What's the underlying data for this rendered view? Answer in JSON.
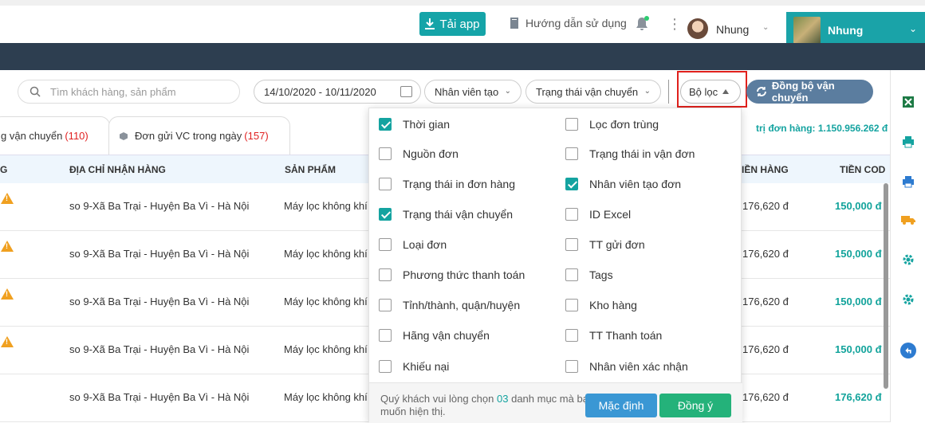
{
  "header": {
    "app_button_label": "Tải app",
    "guide_label": "Hướng dẫn sử dụng",
    "user_name": "Nhung",
    "shop_name": "Nhung"
  },
  "toolbar": {
    "search_placeholder": "Tìm khách hàng, sản phẩm",
    "date_range": "14/10/2020 - 10/11/2020",
    "creator_dropdown": "Nhân viên tạo",
    "status_dropdown": "Trạng thái vận chuyển",
    "filter_label": "Bộ lọc",
    "sync_label": "Đồng bộ vận chuyển"
  },
  "tabs": [
    {
      "label": "g vận chuyển",
      "count": "(110)"
    },
    {
      "label": "Đơn gửi VC trong ngày",
      "count": "(157)"
    }
  ],
  "summary": "trị đơn hàng: 1.150.956.262 đ",
  "table": {
    "headers": [
      "G",
      "ĐỊA CHỈ NHẬN HÀNG",
      "SẢN PHẨM",
      "IỀN HÀNG",
      "TIỀN COD"
    ],
    "rows": [
      {
        "address": "so 9-Xã Ba Trại - Huyện Ba Vì - Hà Nội",
        "product": "Máy lọc không khí",
        "goods": "176,620 đ",
        "cod": "150,000 đ"
      },
      {
        "address": "so 9-Xã Ba Trại - Huyện Ba Vì - Hà Nội",
        "product": "Máy lọc không khí",
        "goods": "176,620 đ",
        "cod": "150,000 đ"
      },
      {
        "address": "so 9-Xã Ba Trại - Huyện Ba Vì - Hà Nội",
        "product": "Máy lọc không khí",
        "goods": "176,620 đ",
        "cod": "150,000 đ"
      },
      {
        "address": "so 9-Xã Ba Trại - Huyện Ba Vì - Hà Nội",
        "product": "Máy lọc không khí",
        "goods": "176,620 đ",
        "cod": "150,000 đ"
      },
      {
        "address": "so 9-Xã Ba Trại - Huyện Ba Vì - Hà Nội",
        "product": "Máy lọc không khí",
        "goods": "176,620 đ",
        "cod": "176,620 đ"
      }
    ]
  },
  "filter_panel": {
    "left": [
      {
        "label": "Thời gian",
        "checked": true
      },
      {
        "label": "Nguồn đơn",
        "checked": false
      },
      {
        "label": "Trạng thái in đơn hàng",
        "checked": false
      },
      {
        "label": "Trạng thái vận chuyển",
        "checked": true
      },
      {
        "label": "Loại đơn",
        "checked": false
      },
      {
        "label": "Phương thức thanh toán",
        "checked": false
      },
      {
        "label": "Tỉnh/thành, quận/huyện",
        "checked": false
      },
      {
        "label": "Hãng vận chuyển",
        "checked": false
      },
      {
        "label": "Khiếu nại",
        "checked": false
      }
    ],
    "right": [
      {
        "label": "Lọc đơn trùng",
        "checked": false
      },
      {
        "label": "Trạng thái in vận đơn",
        "checked": false
      },
      {
        "label": "Nhân viên tạo đơn",
        "checked": true
      },
      {
        "label": "ID Excel",
        "checked": false
      },
      {
        "label": "TT gửi đơn",
        "checked": false
      },
      {
        "label": "Tags",
        "checked": false
      },
      {
        "label": "Kho hàng",
        "checked": false
      },
      {
        "label": "TT Thanh toán",
        "checked": false
      },
      {
        "label": "Nhân viên xác nhận",
        "checked": false
      }
    ],
    "note_prefix": "Quý khách vui lòng chọn",
    "note_count": "03",
    "note_suffix": "danh mục mà bạn muốn hiện thị.",
    "default_button": "Mặc định",
    "agree_button": "Đồng ý"
  },
  "colors": {
    "accent": "#14a3a0",
    "header_dark": "#2d3e50",
    "filter_highlight": "#e0201c",
    "count_red": "#e02020"
  },
  "icons": {
    "right_sidebar": [
      "excel-icon",
      "print-icon",
      "print-icon",
      "truck-icon",
      "settings-icon",
      "settings-icon",
      "back-icon"
    ]
  }
}
